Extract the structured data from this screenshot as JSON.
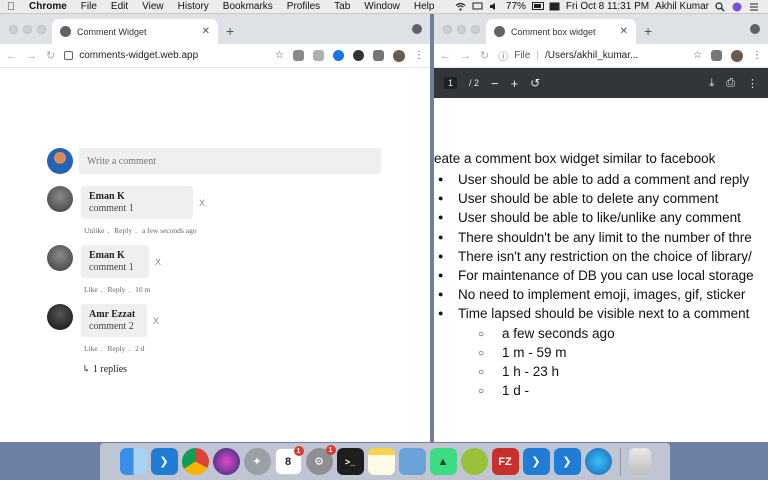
{
  "menubar": {
    "app": "Chrome",
    "items": [
      "File",
      "Edit",
      "View",
      "History",
      "Bookmarks",
      "Profiles",
      "Tab",
      "Window",
      "Help"
    ],
    "battery": "77%",
    "datetime": "Fri Oct 8  11:31 PM",
    "user": "Akhil Kumar"
  },
  "left_window": {
    "tab_title": "Comment Widget",
    "url": "comments-widget.web.app",
    "input_placeholder": "Write a comment",
    "comments": [
      {
        "name": "Eman K",
        "text": "comment 1",
        "delete": "X",
        "like": "Unlike",
        "reply": "Reply",
        "time": "a few seconds ago"
      },
      {
        "name": "Eman K",
        "text": "comment 1",
        "delete": "X",
        "like": "Like",
        "reply": "Reply",
        "time": "10 m"
      },
      {
        "name": "Amr Ezzat",
        "text": "comment 2",
        "delete": "X",
        "like": "Like",
        "reply": "Reply",
        "time": "2 d"
      }
    ],
    "replies_link": "↳ 1 replies"
  },
  "right_window": {
    "tab_title": "Comment box widget",
    "file_label": "File",
    "url": "/Users/akhil_kumar...",
    "page_current": "1",
    "page_total": "/ 2",
    "doc": {
      "title": "eate a comment box widget similar to facebook",
      "bullets": [
        "User should be able to add a comment and reply",
        "User should be able to delete any comment",
        "User should be able to like/unlike any comment",
        "There shouldn't be any limit to the number of thre",
        "There isn't any restriction on the choice of library/",
        "For maintenance of DB you can use local storage",
        "No need to implement emoji, images, gif, sticker",
        "Time lapsed should be visible next to a comment"
      ],
      "sub_bullets": [
        "a few seconds ago",
        "1 m - 59 m",
        "1 h - 23 h",
        "1 d -"
      ]
    }
  },
  "dock": {
    "calendar_day": "8",
    "calendar_badge": "1",
    "prefs_badge": "1",
    "filezilla_label": "FZ"
  },
  "colors": {
    "pdf_toolbar": "#323639",
    "tabstrip": "#dee1e6",
    "comment_bg": "#efefef",
    "vscode": "#1f7dd6"
  }
}
